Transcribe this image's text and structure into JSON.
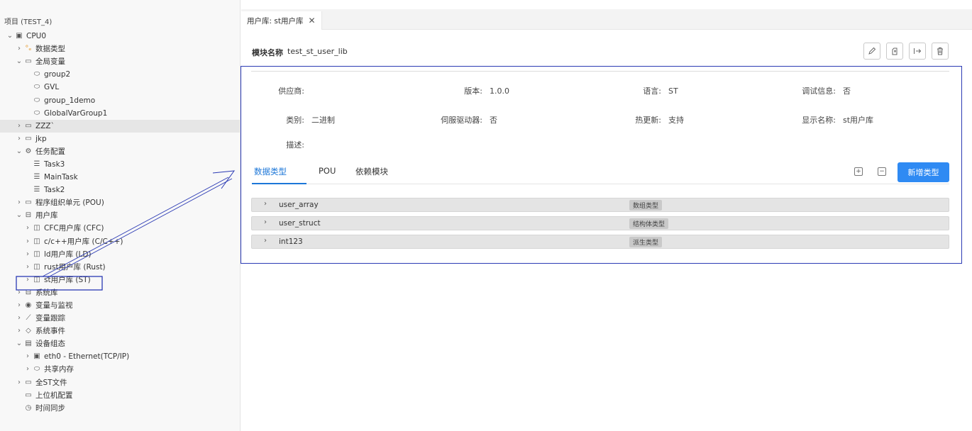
{
  "sidebar": {
    "header": "项目 (TEST_4)",
    "items": [
      {
        "twisty": "⌄",
        "icon": "▣",
        "label": "CPU0",
        "depth": 0
      },
      {
        "twisty": "›",
        "icon": "°ₑ",
        "label": "数据类型",
        "depth": 1,
        "orange": true
      },
      {
        "twisty": "⌄",
        "icon": "▭",
        "label": "全局变量",
        "depth": 1
      },
      {
        "twisty": "",
        "icon": "⬭",
        "label": "group2",
        "depth": 2
      },
      {
        "twisty": "",
        "icon": "⬭",
        "label": "GVL",
        "depth": 2
      },
      {
        "twisty": "",
        "icon": "⬭",
        "label": "group_1demo",
        "depth": 2
      },
      {
        "twisty": "",
        "icon": "⬭",
        "label": "GlobalVarGroup1",
        "depth": 2
      },
      {
        "twisty": "›",
        "icon": "▭",
        "label": "ZZZ`",
        "depth": 1,
        "highlight": true
      },
      {
        "twisty": "›",
        "icon": "▭",
        "label": "jkp",
        "depth": 1
      },
      {
        "twisty": "⌄",
        "icon": "⚙",
        "label": "任务配置",
        "depth": 1
      },
      {
        "twisty": "",
        "icon": "☰",
        "label": "Task3",
        "depth": 2
      },
      {
        "twisty": "",
        "icon": "☰",
        "label": "MainTask",
        "depth": 2
      },
      {
        "twisty": "",
        "icon": "☰",
        "label": "Task2",
        "depth": 2
      },
      {
        "twisty": "›",
        "icon": "▭",
        "label": "程序组织单元 (POU)",
        "depth": 1
      },
      {
        "twisty": "⌄",
        "icon": "⊟",
        "label": "用户库",
        "depth": 1
      },
      {
        "twisty": "›",
        "icon": "◫",
        "label": "CFC用户库 (CFC)",
        "depth": 2
      },
      {
        "twisty": "›",
        "icon": "◫",
        "label": "c/c++用户库 (C/C++)",
        "depth": 2
      },
      {
        "twisty": "›",
        "icon": "◫",
        "label": "ld用户库 (LD)",
        "depth": 2
      },
      {
        "twisty": "›",
        "icon": "◫",
        "label": "rust用户库 (Rust)",
        "depth": 2
      },
      {
        "twisty": "›",
        "icon": "◫",
        "label": "st用户库 (ST)",
        "depth": 2
      },
      {
        "twisty": "›",
        "icon": "⊟",
        "label": "系统库",
        "depth": 1
      },
      {
        "twisty": "›",
        "icon": "◉",
        "label": "变量与监视",
        "depth": 1
      },
      {
        "twisty": "›",
        "icon": "⟋",
        "label": "变量跟踪",
        "depth": 1
      },
      {
        "twisty": "›",
        "icon": "◇",
        "label": "系统事件",
        "depth": 1
      },
      {
        "twisty": "⌄",
        "icon": "▤",
        "label": "设备组态",
        "depth": 1
      },
      {
        "twisty": "›",
        "icon": "▣",
        "label": "eth0 - Ethernet(TCP/IP)",
        "depth": 2
      },
      {
        "twisty": "›",
        "icon": "⬭",
        "label": "共享内存",
        "depth": 2
      },
      {
        "twisty": "›",
        "icon": "▭",
        "label": "全ST文件",
        "depth": 1
      },
      {
        "twisty": "",
        "icon": "▭",
        "label": "上位机配置",
        "depth": 1
      },
      {
        "twisty": "",
        "icon": "◷",
        "label": "时间同步",
        "depth": 1
      }
    ]
  },
  "tab": {
    "label": "用户库: st用户库",
    "close": "✕"
  },
  "module": {
    "key": "模块名称",
    "value": "test_st_user_lib"
  },
  "toolbar": {
    "icons": [
      "edit-icon",
      "export-icon",
      "arrow-right-icon",
      "trash-icon"
    ]
  },
  "info": {
    "vendor": {
      "label": "供应商:",
      "value": ""
    },
    "version": {
      "label": "版本:",
      "value": "1.0.0"
    },
    "language": {
      "label": "语言:",
      "value": "ST"
    },
    "debug": {
      "label": "调试信息:",
      "value": "否"
    },
    "category": {
      "label": "类别:",
      "value": "二进制"
    },
    "servo": {
      "label": "伺服驱动器:",
      "value": "否"
    },
    "hotupdate": {
      "label": "热更新:",
      "value": "支持"
    },
    "display": {
      "label": "显示名称:",
      "value": "st用户库"
    },
    "desc": {
      "label": "描述:",
      "value": ""
    }
  },
  "subtabs": [
    "数据类型",
    "POU",
    "依赖模块"
  ],
  "add_type_label": "新增类型",
  "types": [
    {
      "name": "user_array",
      "kind": "数组类型"
    },
    {
      "name": "user_struct",
      "kind": "结构体类型"
    },
    {
      "name": "int123",
      "kind": "派生类型"
    }
  ],
  "colors": {
    "accent": "#2f8af3",
    "annotation": "#2b3ab4"
  }
}
